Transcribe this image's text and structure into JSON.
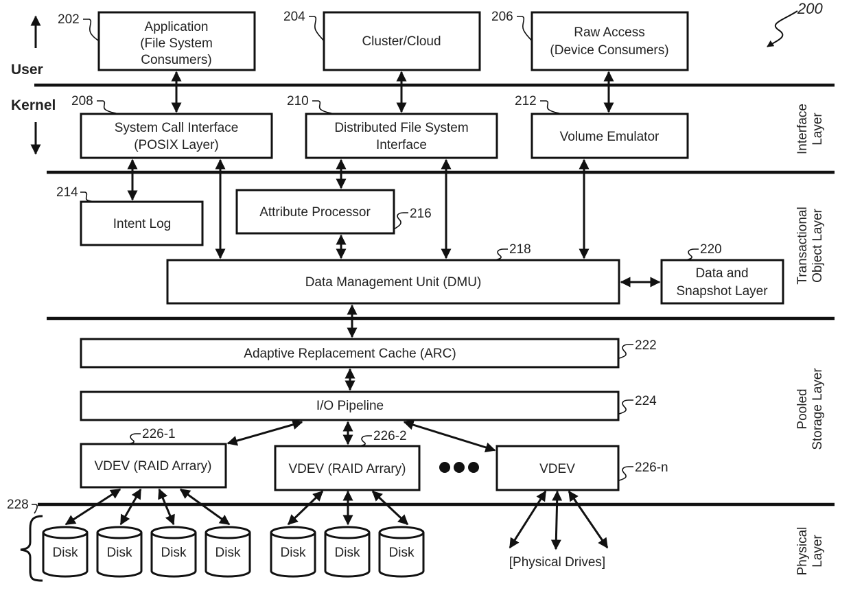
{
  "figure": {
    "ref": "200",
    "zones": {
      "user": "User",
      "kernel": "Kernel"
    },
    "layers": {
      "interface": [
        "Interface",
        "Layer"
      ],
      "transactional": [
        "Transactional",
        "Object Layer"
      ],
      "pooled": [
        "Pooled",
        "Storage Layer"
      ],
      "physical": [
        "Physical",
        "Layer"
      ]
    },
    "boxes": {
      "application": {
        "ref": "202",
        "lines": [
          "Application",
          "(File System",
          "Consumers)"
        ]
      },
      "cluster": {
        "ref": "204",
        "lines": [
          "Cluster/Cloud"
        ]
      },
      "raw_access": {
        "ref": "206",
        "lines": [
          "Raw Access",
          "(Device Consumers)"
        ]
      },
      "syscall": {
        "ref": "208",
        "lines": [
          "System Call Interface",
          "(POSIX Layer)"
        ]
      },
      "dfs": {
        "ref": "210",
        "lines": [
          "Distributed File System",
          "Interface"
        ]
      },
      "volume": {
        "ref": "212",
        "lines": [
          "Volume Emulator"
        ]
      },
      "intent_log": {
        "ref": "214",
        "lines": [
          "Intent Log"
        ]
      },
      "attr_proc": {
        "ref": "216",
        "lines": [
          "Attribute Processor"
        ]
      },
      "dmu": {
        "ref": "218",
        "lines": [
          "Data Management Unit (DMU)"
        ]
      },
      "snapshot": {
        "ref": "220",
        "lines": [
          "Data and",
          "Snapshot Layer"
        ]
      },
      "arc": {
        "ref": "222",
        "lines": [
          "Adaptive Replacement Cache (ARC)"
        ]
      },
      "io": {
        "ref": "224",
        "lines": [
          "I/O Pipeline"
        ]
      },
      "vdev1": {
        "ref": "226-1",
        "lines": [
          "VDEV (RAID Arrary)"
        ]
      },
      "vdev2": {
        "ref": "226-2",
        "lines": [
          "VDEV (RAID Arrary)"
        ]
      },
      "vdevn": {
        "ref": "226-n",
        "lines": [
          "VDEV"
        ]
      }
    },
    "disks": {
      "ref": "228",
      "label": "Disk",
      "count_group1": 4,
      "count_group2": 3
    },
    "physical_drives": "[Physical Drives]",
    "ellipsis": "●●●"
  }
}
